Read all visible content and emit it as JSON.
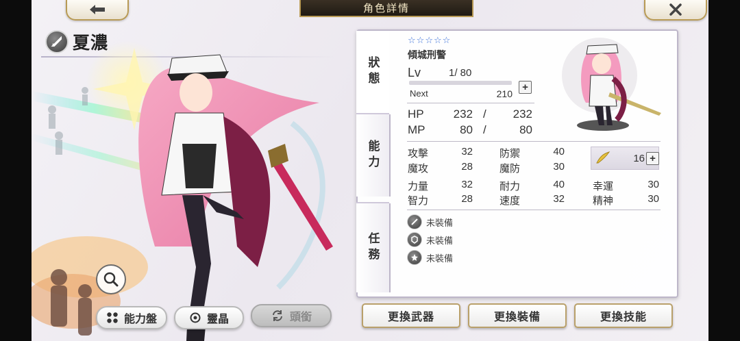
{
  "header": {
    "title": "角色詳情"
  },
  "character": {
    "name": "夏濃",
    "title": "傾城刑警",
    "stars": 5
  },
  "tabs": [
    "狀態",
    "能力",
    "任務"
  ],
  "level": {
    "label": "Lv",
    "value": "1/ 80",
    "next_label": "Next",
    "next_value": "210",
    "exp_fraction": 0.0
  },
  "hp": {
    "label": "HP",
    "current": "232",
    "sep": "/",
    "max": "232"
  },
  "mp": {
    "label": "MP",
    "current": "80",
    "sep": "/",
    "max": "80"
  },
  "stats": [
    {
      "label": "攻擊",
      "value": "32"
    },
    {
      "label": "防禦",
      "value": "40"
    },
    {
      "label": "魔攻",
      "value": "28"
    },
    {
      "label": "魔防",
      "value": "30"
    },
    {
      "label": "力量",
      "value": "32"
    },
    {
      "label": "耐力",
      "value": "40"
    },
    {
      "label": "幸運",
      "value": "30"
    },
    {
      "label": "智力",
      "value": "28"
    },
    {
      "label": "速度",
      "value": "32"
    },
    {
      "label": "精神",
      "value": "30"
    }
  ],
  "skill_points": {
    "value": "16"
  },
  "equipment": [
    {
      "label": "未裝備",
      "icon": "sword-icon"
    },
    {
      "label": "未裝備",
      "icon": "armor-icon"
    },
    {
      "label": "未裝備",
      "icon": "accessory-icon"
    }
  ],
  "buttons": {
    "ability_board": "能力盤",
    "spirit_crystal": "靈晶",
    "title_btn": "頭銜",
    "change_weapon": "更換武器",
    "change_equipment": "更換裝備",
    "change_skill": "更換技能"
  },
  "colors": {
    "accent_gold": "#b89a55",
    "star_blue": "#3a6fd8",
    "panel_border": "#bdb6c9"
  }
}
